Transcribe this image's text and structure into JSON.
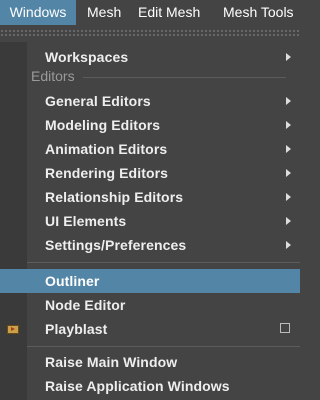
{
  "menubar": {
    "items": [
      {
        "label": "Windows",
        "active": true
      },
      {
        "label": "Mesh",
        "active": false
      },
      {
        "label": "Edit Mesh",
        "active": false
      },
      {
        "label": "Mesh Tools",
        "active": false
      }
    ]
  },
  "dropdown": {
    "workspaces": {
      "label": "Workspaces",
      "submenu": true
    },
    "editors_header": "Editors",
    "editors": [
      {
        "label": "General Editors",
        "submenu": true
      },
      {
        "label": "Modeling Editors",
        "submenu": true
      },
      {
        "label": "Animation Editors",
        "submenu": true
      },
      {
        "label": "Rendering Editors",
        "submenu": true
      },
      {
        "label": "Relationship Editors",
        "submenu": true
      },
      {
        "label": "UI Elements",
        "submenu": true
      },
      {
        "label": "Settings/Preferences",
        "submenu": true
      }
    ],
    "outliner": {
      "label": "Outliner",
      "highlighted": true
    },
    "node_editor": {
      "label": "Node Editor"
    },
    "playblast": {
      "label": "Playblast",
      "icon": "playblast-icon",
      "option_box": true
    },
    "raise_main": {
      "label": "Raise Main Window"
    },
    "raise_app": {
      "label": "Raise Application Windows"
    }
  },
  "colors": {
    "background": "#444444",
    "highlight": "#5285a6",
    "text": "#eeeeee",
    "section_header": "#9a9a9a"
  }
}
